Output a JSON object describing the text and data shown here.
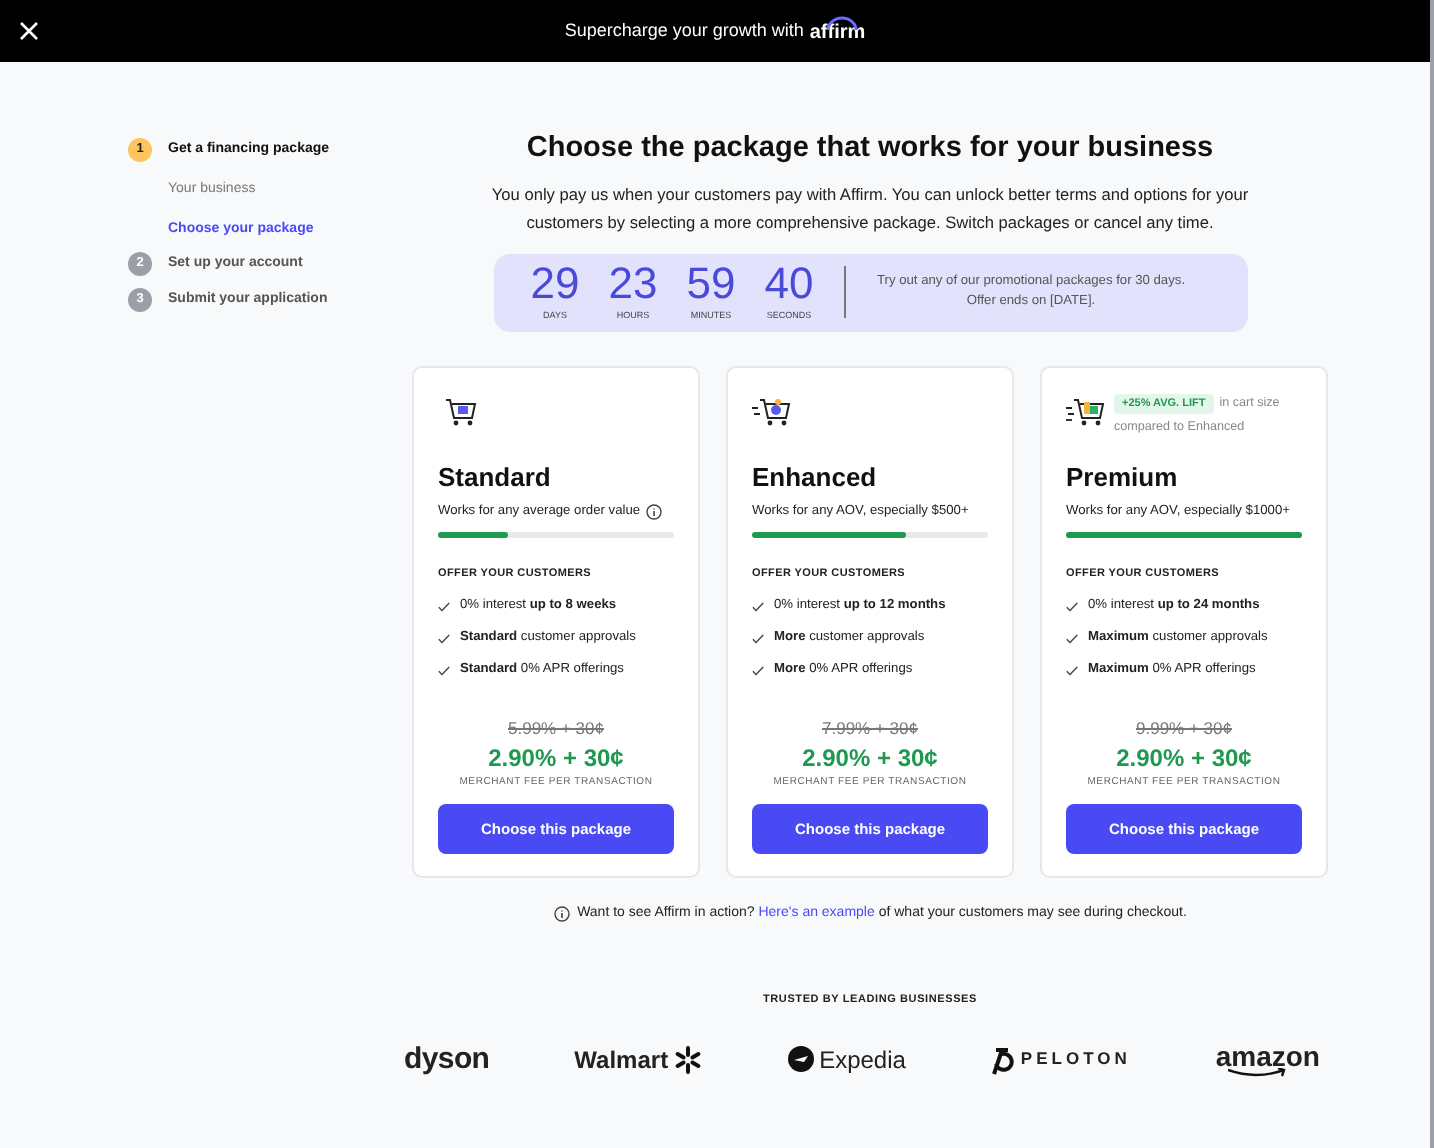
{
  "top_bar": {
    "title": "Supercharge your growth with",
    "brand": "affirm"
  },
  "steps": [
    {
      "number": "1",
      "label": "Get a financing package",
      "active": true,
      "substeps": [
        {
          "label": "Your business",
          "selected": false
        },
        {
          "label": "Choose your package",
          "selected": true
        }
      ]
    },
    {
      "number": "2",
      "label": "Set up your account",
      "active": false
    },
    {
      "number": "3",
      "label": "Submit your application",
      "active": false
    }
  ],
  "heading": "Choose the package that works for your business",
  "intro": "You only pay us when your customers pay with Affirm. You can unlock better terms and options for your customers by selecting a more comprehensive package. Switch packages or cancel any time.",
  "countdown": {
    "units": [
      {
        "value": "29",
        "label": "DAYS"
      },
      {
        "value": "23",
        "label": "HOURS"
      },
      {
        "value": "59",
        "label": "MINUTES"
      },
      {
        "value": "40",
        "label": "SECONDS"
      }
    ],
    "note": "Try out any of our promotional packages for 30 days. Offer ends on [DATE]."
  },
  "packages": [
    {
      "name": "Standard",
      "kind": "basic",
      "subtitle": "Works for any average order value",
      "info": true,
      "level": 0.3,
      "offer_heading": "OFFER YOUR CUSTOMERS",
      "features": [
        "0% interest **up to 8 weeks**",
        "**Standard** customer approvals",
        "**Standard** 0% APR offerings"
      ],
      "old_price": "5.99% + 30¢",
      "price": "2.90% + 30¢",
      "fee_label": "MERCHANT FEE PER TRANSACTION",
      "button": "Choose this package"
    },
    {
      "name": "Enhanced",
      "kind": "fast",
      "subtitle": "Works for any AOV, especially $500+",
      "info": false,
      "level": 0.65,
      "offer_heading": "OFFER YOUR CUSTOMERS",
      "features": [
        "0% interest **up to 12 months**",
        "**More** customer approvals",
        "**More** 0% APR offerings"
      ],
      "old_price": "7.99% + 30¢",
      "price": "2.90% + 30¢",
      "fee_label": "MERCHANT FEE PER TRANSACTION",
      "button": "Choose this package"
    },
    {
      "name": "Premium",
      "kind": "full",
      "badge": "+25% AVG. LIFT",
      "badge_text": "in cart size compared to Enhanced",
      "subtitle": "Works for any AOV, especially $1000+",
      "info": false,
      "level": 1,
      "offer_heading": "OFFER YOUR CUSTOMERS",
      "features": [
        "0% interest **up to 24 months**",
        "**Maximum** customer approvals",
        "**Maximum** 0% APR offerings"
      ],
      "old_price": "9.99% + 30¢",
      "price": "2.90% + 30¢",
      "fee_label": "MERCHANT FEE PER TRANSACTION",
      "button": "Choose this package"
    }
  ],
  "example_note": {
    "before": "Want to see Affirm in action?",
    "link": "Here's an example",
    "after": "of what your customers may see during checkout."
  },
  "trusted": {
    "heading": "TRUSTED BY LEADING BUSINESSES",
    "logos": [
      {
        "kind": "dyson",
        "text": "dyson"
      },
      {
        "kind": "walmart",
        "text": "Walmart"
      },
      {
        "kind": "expedia",
        "text": "Expedia"
      },
      {
        "kind": "peloton",
        "text": "PELOTON"
      },
      {
        "kind": "amazon",
        "text": "amazon"
      }
    ]
  }
}
